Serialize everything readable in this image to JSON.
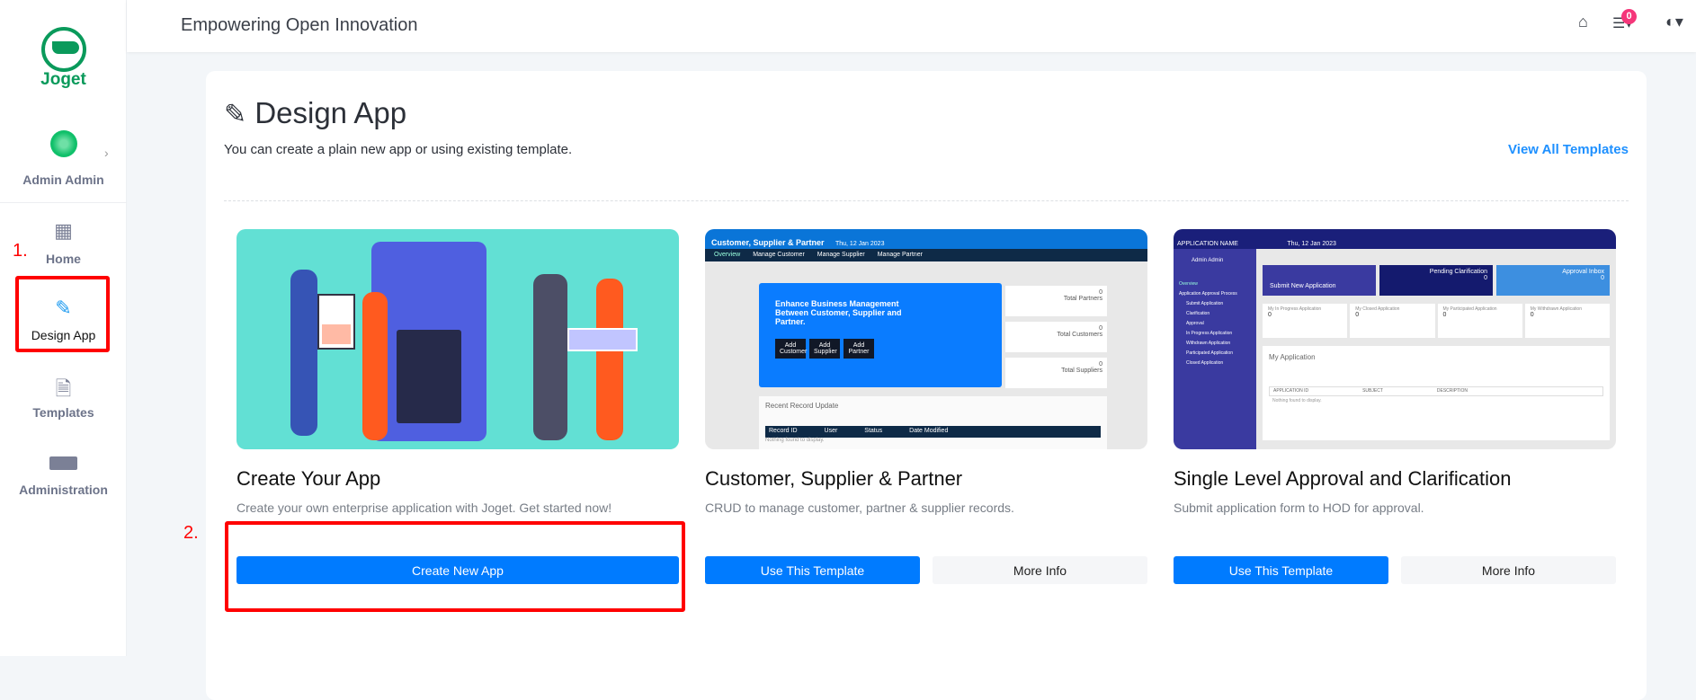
{
  "header": {
    "title": "Empowering Open Innovation",
    "notification_count": "0"
  },
  "sidebar": {
    "logo_text": "Joget",
    "user": "Admin Admin",
    "items": [
      {
        "label": "Home",
        "icon": "grid-icon"
      },
      {
        "label": "Design App",
        "icon": "design-icon"
      },
      {
        "label": "Templates",
        "icon": "file-zip-icon"
      },
      {
        "label": "Administration",
        "icon": "console-icon"
      }
    ]
  },
  "page": {
    "title": "Design App",
    "subtitle": "You can create a plain new app or using existing template.",
    "view_all": "View All Templates"
  },
  "annotations": {
    "step1": "1.",
    "step2": "2."
  },
  "cards": [
    {
      "title": "Create Your App",
      "desc": "Create your own enterprise application with Joget. Get started now!",
      "primary": "Create New App"
    },
    {
      "title": "Customer, Supplier & Partner",
      "desc": "CRUD to manage customer, partner & supplier records.",
      "primary": "Use This Template",
      "secondary": "More Info",
      "thumb": {
        "app": "Customer, Supplier & Partner",
        "date": "Thu, 12 Jan 2023",
        "tabs": [
          "Overview",
          "Manage Customer",
          "Manage Supplier",
          "Manage Partner"
        ],
        "banner": "Enhance Business Management Between Customer, Supplier and Partner.",
        "buttons": [
          "Add Customer",
          "Add Supplier",
          "Add Partner"
        ],
        "stats": [
          {
            "value": "0",
            "label": "Total Partners"
          },
          {
            "value": "0",
            "label": "Total Customers"
          },
          {
            "value": "0",
            "label": "Total Suppliers"
          }
        ],
        "recent": "Recent Record Update",
        "columns": [
          "Record ID",
          "User",
          "Status",
          "Date Modified"
        ],
        "empty": "Nothing found to display."
      }
    },
    {
      "title": "Single Level Approval and Clarification",
      "desc": "Submit application form to HOD for approval.",
      "primary": "Use This Template",
      "secondary": "More Info",
      "thumb": {
        "app": "APPLICATION NAME",
        "date": "Thu, 12 Jan 2023",
        "user": "Admin Admin",
        "menu": [
          "Overview",
          "Application Approval Process",
          "Submit Application",
          "Clarification",
          "Approval",
          "In Progress Application",
          "Withdrawn Application",
          "Participated Application",
          "Closed Application"
        ],
        "tiles": [
          {
            "label": "Submit New Application"
          },
          {
            "label": "Pending Clarification",
            "value": "0"
          },
          {
            "label": "Approval Inbox",
            "value": "0"
          }
        ],
        "stats": [
          {
            "label": "My In Progress Application",
            "value": "0"
          },
          {
            "label": "My Closed Application",
            "value": "0"
          },
          {
            "label": "My Participated Application",
            "value": "0"
          },
          {
            "label": "My Withdrawn Application",
            "value": "0"
          }
        ],
        "section": "My Application",
        "columns": [
          "APPLICATION ID",
          "SUBJECT",
          "DESCRIPTION"
        ],
        "empty": "Nothing found to display."
      }
    }
  ]
}
